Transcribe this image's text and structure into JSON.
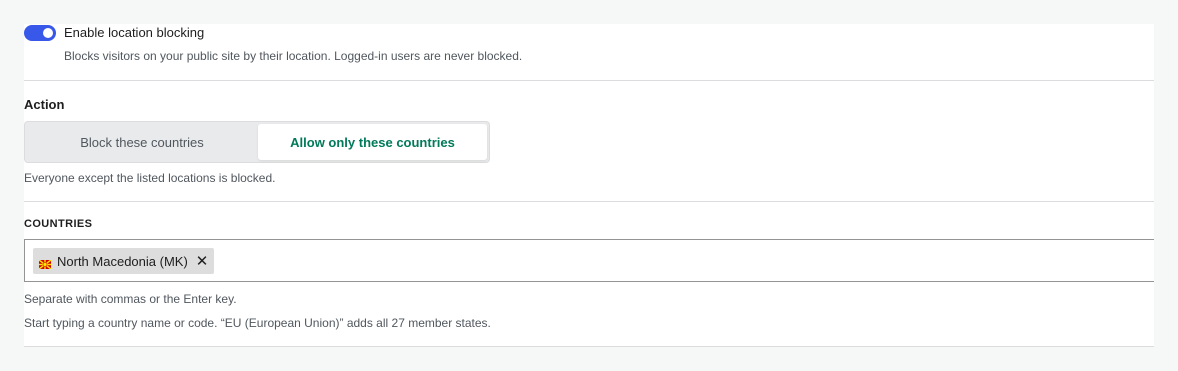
{
  "location_blocking": {
    "toggle_label": "Enable location blocking",
    "enabled": true,
    "help": "Blocks visitors on your public site by their location. Logged-in users are never blocked."
  },
  "action": {
    "label": "Action",
    "options": [
      "Block these countries",
      "Allow only these countries"
    ],
    "selected": "Allow only these countries",
    "help": "Everyone except the listed locations is blocked."
  },
  "countries": {
    "label": "COUNTRIES",
    "tokens": [
      {
        "label": "North Macedonia (MK)",
        "flag_icon": "north-macedonia-flag-icon",
        "remove_glyph": "✕"
      }
    ],
    "help_separator": "Separate with commas or the Enter key.",
    "help_typing": "Start typing a country name or code. “EU (European Union)” adds all 27 member states."
  },
  "colors": {
    "toggle_on": "#3858e9",
    "selected_option_text": "#007a5a",
    "page_background": "#f6f7f7"
  }
}
